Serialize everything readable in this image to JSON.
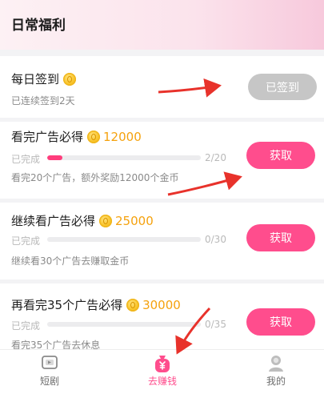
{
  "header": {
    "title": "日常福利"
  },
  "tasks": [
    {
      "title": "每日签到",
      "subtitle": "已连续签到2天",
      "button_label": "已签到"
    },
    {
      "title": "看完广告必得",
      "reward": "12000",
      "status": "已完成",
      "progress": 0.1,
      "count": "2/20",
      "description": "看完20个广告，额外奖励12000个金币",
      "button_label": "获取"
    },
    {
      "title": "继续看广告必得",
      "reward": "25000",
      "status": "已完成",
      "progress": 0,
      "count": "0/30",
      "description": "继续看30个广告去赚取金币",
      "button_label": "获取"
    },
    {
      "title": "再看完35个广告必得",
      "reward": "30000",
      "status": "已完成",
      "progress": 0,
      "count": "0/35",
      "description": "看完35个广告去休息",
      "button_label": "获取"
    }
  ],
  "nav": [
    {
      "label": "短剧",
      "icon": "video-icon"
    },
    {
      "label": "去赚钱",
      "icon": "money-bag-icon",
      "active": true
    },
    {
      "label": "我的",
      "icon": "profile-icon"
    }
  ],
  "colors": {
    "accent": "#ff4d8d",
    "progress": "#ff3d7c",
    "reward": "#f5a20e",
    "done_button": "#c6c6c6",
    "arrow": "#e8322b"
  }
}
